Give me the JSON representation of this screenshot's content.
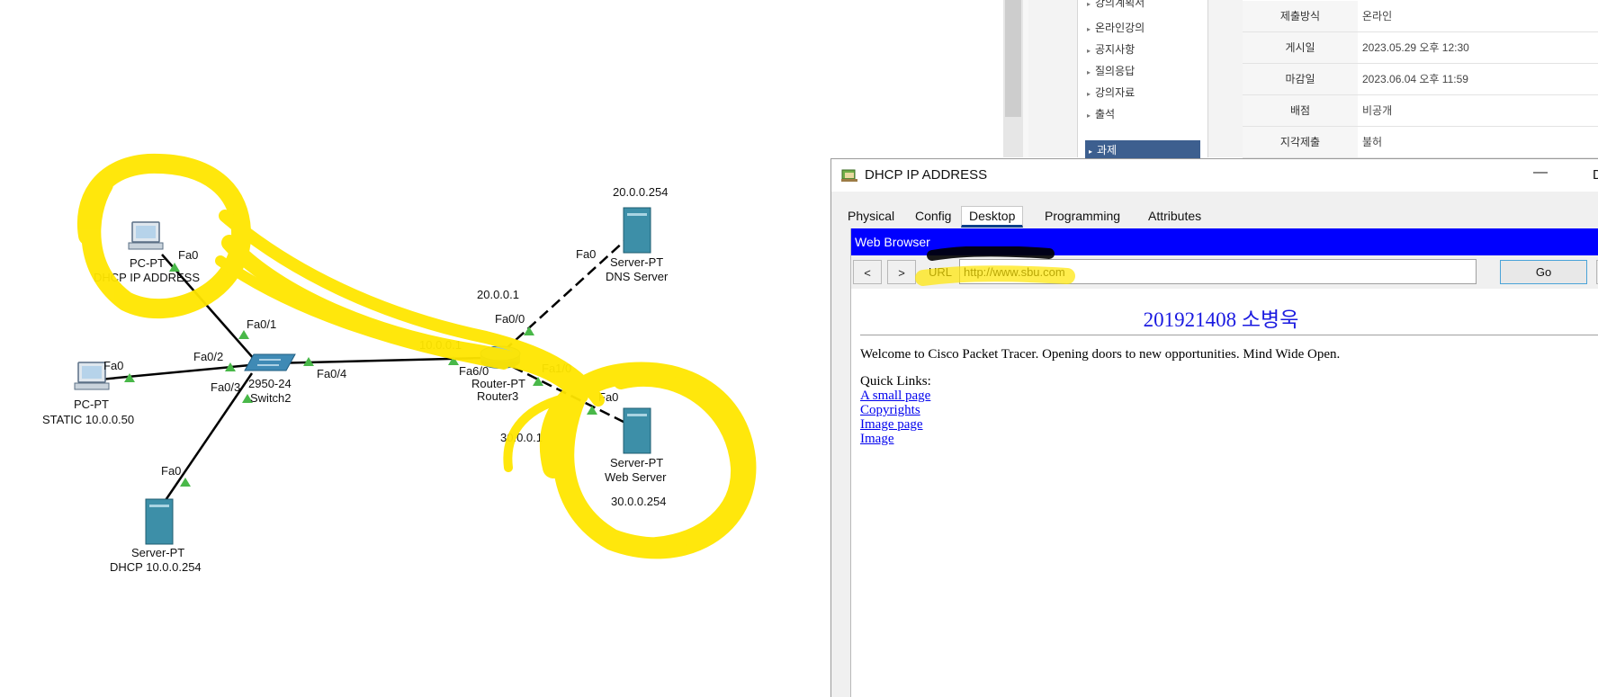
{
  "lms": {
    "sidebar_items": [
      "강의계획서",
      "온라인강의",
      "공지사항",
      "질의응답",
      "강의자료",
      "출석",
      "과제"
    ],
    "active_item": "과제",
    "rows": [
      {
        "key": "제출방식",
        "value": "온라인"
      },
      {
        "key": "게시일",
        "value": "2023.05.29 오후 12:30"
      },
      {
        "key": "마감일",
        "value": "2023.06.04 오후 11:59"
      },
      {
        "key": "배점",
        "value": "비공개"
      },
      {
        "key": "지각제출",
        "value": "불허"
      }
    ]
  },
  "topology": {
    "pc_dhcp": {
      "type": "PC-PT",
      "name": "DHCP IP ADDRESS",
      "port": "Fa0"
    },
    "pc_static": {
      "type": "PC-PT",
      "name": "STATIC 10.0.0.50",
      "port": "Fa0"
    },
    "server_dhcp": {
      "type": "Server-PT",
      "name": "DHCP 10.0.0.254",
      "port": "Fa0"
    },
    "switch": {
      "model": "2950-24",
      "name": "Switch2",
      "ports": [
        "Fa0/1",
        "Fa0/2",
        "Fa0/3",
        "Fa0/4"
      ]
    },
    "router": {
      "type": "Router-PT",
      "name": "Router3",
      "ports": [
        "Fa6/0",
        "Fa0/0",
        "Fa1/0"
      ],
      "ip_fa6": "10.0.0.1",
      "ip_fa0": "20.0.0.1",
      "ip_fa1": "30.0.0.1"
    },
    "dns_server": {
      "type": "Server-PT",
      "name": "DNS Server",
      "ip": "20.0.0.254",
      "port": "Fa0"
    },
    "web_server": {
      "type": "Server-PT",
      "name": "Web Server",
      "ip": "30.0.0.254",
      "port": "Fa0"
    }
  },
  "window": {
    "title": "DHCP IP ADDRESS",
    "minimize": "—",
    "tabs": [
      "Physical",
      "Config",
      "Desktop",
      "Programming",
      "Attributes"
    ],
    "active_tab": "Desktop",
    "browser": {
      "header": "Web Browser",
      "back": "<",
      "forward": ">",
      "url_label": "URL",
      "url": "http://www.sbu.com",
      "go": "Go",
      "heading": "201921408 소병욱",
      "welcome": "Welcome to Cisco Packet Tracer. Opening doors to new opportunities. Mind Wide Open.",
      "quick_links_label": "Quick Links:",
      "links": [
        "A small page",
        "Copyrights",
        "Image page",
        "Image"
      ]
    }
  },
  "colors": {
    "highlight": "#ffe600",
    "browser_header": "#0000ff",
    "heading_blue": "#1a1ae0",
    "active_menu": "#3d5f8f",
    "link_up": "#49b849"
  }
}
